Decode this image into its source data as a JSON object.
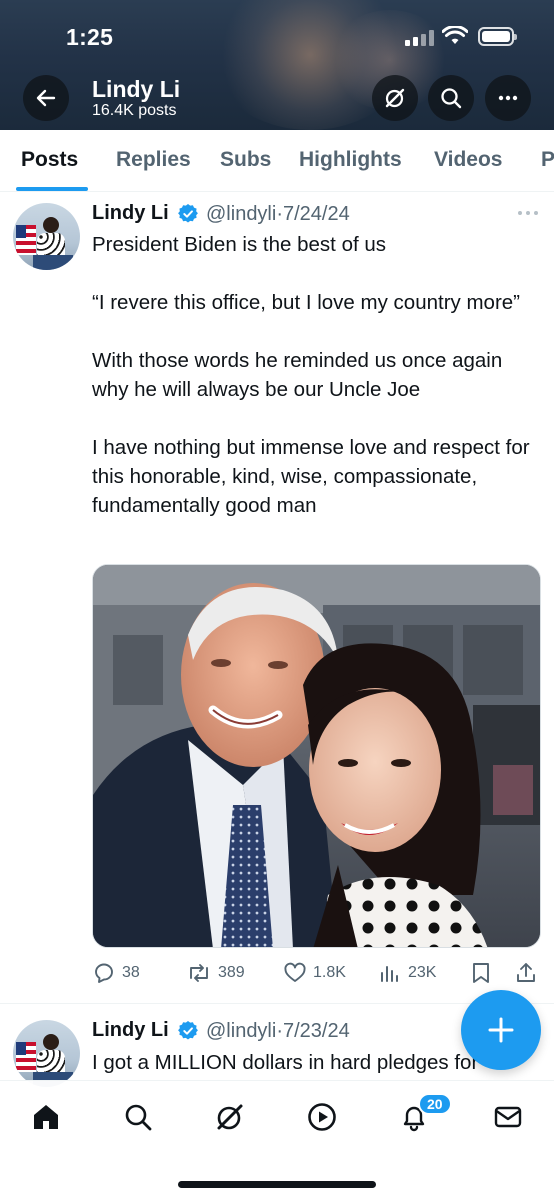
{
  "status_bar": {
    "time": "1:25"
  },
  "header": {
    "name": "Lindy Li",
    "posts": "16.4K posts"
  },
  "tabs": [
    {
      "label": "Posts",
      "active": true
    },
    {
      "label": "Replies",
      "active": false
    },
    {
      "label": "Subs",
      "active": false
    },
    {
      "label": "Highlights",
      "active": false
    },
    {
      "label": "Videos",
      "active": false
    },
    {
      "label": "P",
      "active": false
    }
  ],
  "tweets": [
    {
      "name": "Lindy Li",
      "handle": "@lindyli",
      "sep": "·",
      "date": "7/24/24",
      "text": "President Biden is the best of us\n\n“I revere this office, but I love my country more”\n\nWith those words he reminded us once again why he will always be our Uncle Joe\n\nI have nothing but immense love and respect for this honorable, kind, wise, compassionate, fundamentally good man",
      "actions": {
        "replies": "38",
        "reposts": "389",
        "likes": "1.8K",
        "views": "23K"
      }
    },
    {
      "name": "Lindy Li",
      "handle": "@lindyli",
      "sep": "·",
      "date": "7/23/24",
      "text": "I got a MILLION dollars in hard pledges for"
    }
  ],
  "bottom_nav": {
    "notifications_badge": "20"
  },
  "icons": {
    "back": "arrow-left-icon",
    "grok": "grok-icon",
    "search": "search-icon",
    "more": "more-icon",
    "verified": "verified-badge-icon",
    "reply": "reply-icon",
    "repost": "repost-icon",
    "like": "heart-icon",
    "views": "views-icon",
    "bookmark": "bookmark-icon",
    "share": "share-icon",
    "compose": "plus-icon",
    "home": "home-icon",
    "communities": "grok-icon",
    "video": "play-icon",
    "notifications": "bell-icon",
    "messages": "mail-icon"
  },
  "colors": {
    "accent": "#1d9bf0",
    "text": "#0f1419",
    "secondary": "#536471"
  }
}
